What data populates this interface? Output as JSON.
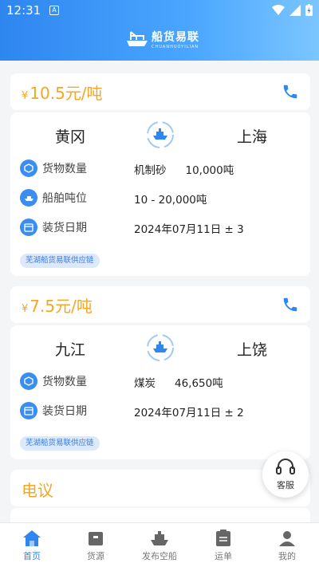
{
  "status_bar": {
    "time": "12:31",
    "sim_glyph": "A"
  },
  "app": {
    "name_cn": "船货易联",
    "name_en": "CHUANHUOYILIAN"
  },
  "listings": [
    {
      "price": "10.5元/吨",
      "currency": "¥",
      "from": "黄冈",
      "to": "上海",
      "rows": [
        {
          "icon": "cube-icon",
          "label": "货物数量",
          "value": "机制砂",
          "value2": "10,000吨"
        },
        {
          "icon": "ship-icon",
          "label": "船舶吨位",
          "value": "10 - 20,000吨",
          "value2": ""
        },
        {
          "icon": "calendar-icon",
          "label": "装货日期",
          "value": "2024年07月11日 ± 3",
          "value2": ""
        }
      ],
      "tag": "芜湖船货易联供应链"
    },
    {
      "price": "7.5元/吨",
      "currency": "¥",
      "from": "九江",
      "to": "上饶",
      "rows": [
        {
          "icon": "cube-icon",
          "label": "货物数量",
          "value": "煤炭",
          "value2": "46,650吨"
        },
        {
          "icon": "calendar-icon",
          "label": "装货日期",
          "value": "2024年07月11日 ± 2",
          "value2": ""
        }
      ],
      "tag": "芜湖船货易联供应链"
    }
  ],
  "third_price": "电议",
  "customer_service": "客服",
  "tabs": [
    {
      "label": "首页",
      "icon": "home-icon",
      "active": true
    },
    {
      "label": "货源",
      "icon": "box-icon",
      "active": false
    },
    {
      "label": "发布空船",
      "icon": "ship-icon",
      "active": false
    },
    {
      "label": "运单",
      "icon": "document-icon",
      "active": false
    },
    {
      "label": "我的",
      "icon": "user-icon",
      "active": false
    }
  ],
  "colors": {
    "accent": "#2e86f0",
    "price": "#f5a623",
    "tag_bg": "#dbe9fb"
  }
}
